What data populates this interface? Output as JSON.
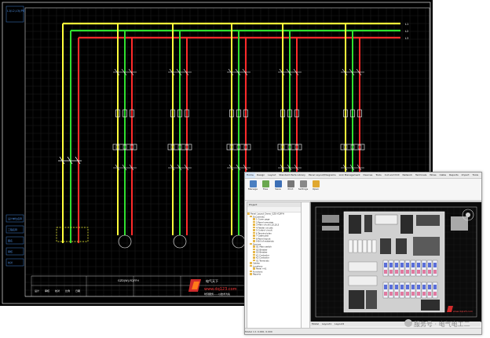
{
  "schematic": {
    "top_left_label": "L1(L2,L3)(PE)",
    "bus_labels": [
      "L1",
      "L2",
      "L3"
    ],
    "left_side_labels": [
      "设计单位名称",
      "工程名称",
      "图名",
      "审核",
      "校对"
    ],
    "title_block": {
      "drawing_name": "GZD(W)-YCJFFH",
      "company_site": "www.dq123.com",
      "company_slogan": "电气天下",
      "company_sub": "时刻服务——以技术为先",
      "fields": [
        "设计",
        "审核",
        "校对",
        "比例",
        "日期"
      ]
    },
    "feeder_count": 6
  },
  "cad": {
    "menu": [
      "Home",
      "Design",
      "Layout",
      "Standard Parts Library",
      "Panel Layout/Diagrams",
      "Link Management",
      "Devices",
      "Tools",
      "Cut and Drill",
      "Network",
      "Terminals",
      "Wires",
      "Cable",
      "Reports",
      "Import",
      "Tools",
      "Annotations",
      "Help"
    ],
    "ribbon": [
      {
        "label": "Manage",
        "icon": "project-icon",
        "color": "#4a7fc1"
      },
      {
        "label": "Tree",
        "icon": "tree-icon",
        "color": "#6aa84f"
      },
      {
        "label": "Save",
        "icon": "save-icon",
        "color": "#3d6fb5"
      },
      {
        "label": "Print",
        "icon": "print-icon",
        "color": "#777777"
      },
      {
        "label": "Settings",
        "icon": "settings-icon",
        "color": "#888888"
      },
      {
        "label": "Open",
        "icon": "open-icon",
        "color": "#e0a830"
      }
    ],
    "tree_panel_title": "Project",
    "tree_items": [
      "Panel_Layout_Demo_GZD-YCJFFH",
      "Documents",
      "1 Cover page",
      "2 Panel overview",
      "3 Main circuit L1/L2/L3",
      "4 Feeder circuits",
      "5 Control circuit",
      "6 Terminal plan",
      "7 Cable plan",
      "8 Panel layout",
      "9 Bill of materials",
      "Devices",
      "Q1 Main switch",
      "Q2 Breaker",
      "Q3 Breaker",
      "K1 Contactor",
      "K2 Contactor",
      "X1 Terminals",
      "Cables",
      "Locations",
      "Panel +A1",
      "Functions",
      "Reports"
    ],
    "bottom_tabs": [
      "Model",
      "Layout1",
      "Layout2"
    ],
    "status_text": "Model  1:1  0.000, 0.000"
  },
  "watermark": "服务号 · 电气电工二"
}
